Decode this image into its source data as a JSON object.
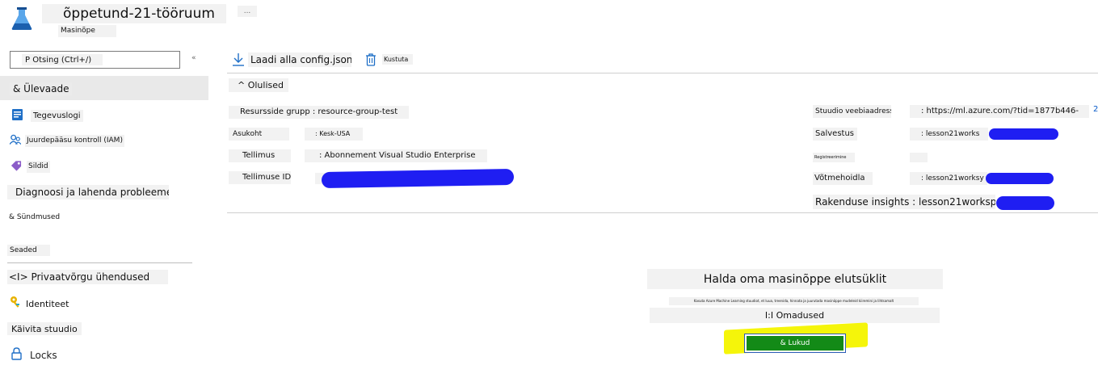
{
  "header": {
    "title": "õppetund-21-tööruum",
    "subtitle": "Masinõpe",
    "more_label": "...",
    "logo_icon": "azure-ml-flask-icon",
    "brand_color": "#1b6ec2"
  },
  "sidebar": {
    "search_placeholder": "P Otsing (Ctrl+/)",
    "collapse_label": "«",
    "items": [
      {
        "label": "& Ülevaade",
        "icon": "none"
      },
      {
        "label": "Tegevuslogi",
        "icon": "activity-log-icon"
      },
      {
        "label": "Juurdepääsu kontroll (IAM)",
        "icon": "people-icon"
      },
      {
        "label": "Sildid",
        "icon": "tag-icon"
      },
      {
        "label": "Diagnoosi ja lahenda probleeme",
        "icon": "none"
      },
      {
        "label": "& Sündmused",
        "icon": "none"
      },
      {
        "label": "Seaded",
        "icon": "none"
      },
      {
        "label": "<I> Privaatvõrgu ühendused",
        "icon": "none"
      },
      {
        "label": "Identiteet",
        "icon": "key-icon"
      },
      {
        "label": "Käivita stuudio",
        "icon": "none"
      },
      {
        "label": "Locks",
        "icon": "lock-icon"
      }
    ]
  },
  "toolbar": {
    "download_label": "Laadi alla config.json",
    "delete_label": "Kustuta"
  },
  "essentials": {
    "toggle_label": "^ Olulised",
    "resource_group": "Resursside grupp : resource-group-test",
    "location_label": "Asukoht",
    "location_value": ": Kesk-USA",
    "subscription_label": "Tellimus",
    "subscription_value": ": Abonnement Visual Studio Enterprise",
    "subscription_id_label": "Tellimuse ID :",
    "studio_label": "Stuudio veebiaadress",
    "studio_value": ": https://ml.azure.com/?tid=1877b446-",
    "studio_more": "2",
    "storage_label": "Salvestus",
    "storage_value": ": lesson21works",
    "registry_label": "Registreerimine",
    "keyvault_label": "Võtmehoidla",
    "keyvault_value": ": lesson21worksy",
    "app_insights": "Rakenduse insights : lesson21worksp."
  },
  "lifecycle": {
    "title": "Halda oma masinõppe elutsüklit",
    "description": "Kasuta Azure Machine Learning stuudiot, et luua, treenida, hinnata ja juurutada masinõppe mudeleid kiiremini ja lihtsamalt",
    "properties_label": "I:I Omadused",
    "locks_button": "& Lukud",
    "button_color": "#138a17",
    "highlight_color": "#f5f50a"
  },
  "redaction_color": "#1f1ef2"
}
